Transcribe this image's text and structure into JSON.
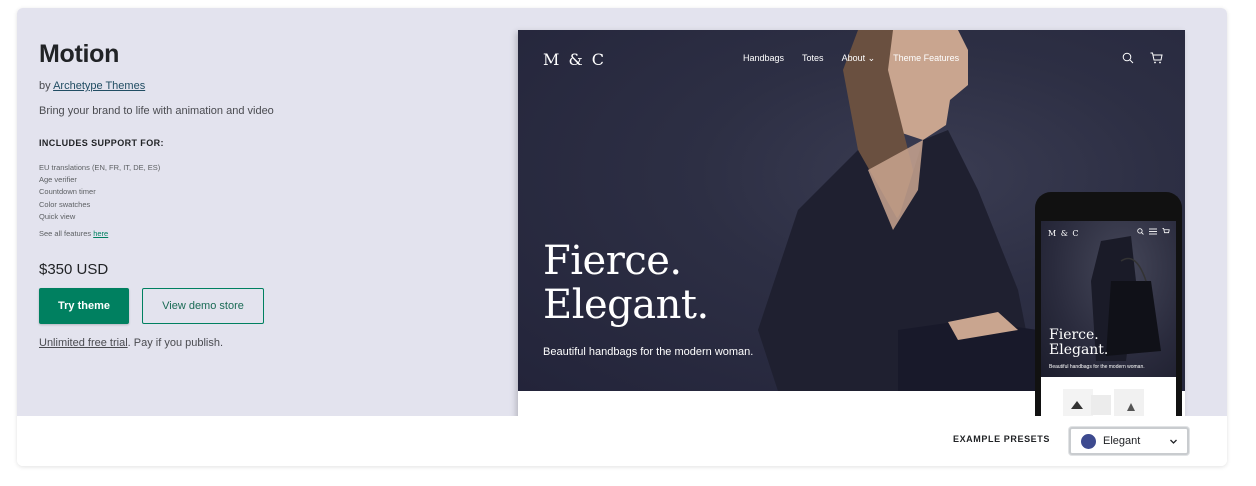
{
  "theme": {
    "title": "Motion",
    "by_prefix": "by ",
    "author": "Archetype Themes",
    "description": "Bring your brand to life with animation and video",
    "includes_heading": "INCLUDES SUPPORT FOR:",
    "features": [
      "EU translations (EN, FR, IT, DE, ES)",
      "Age verifier",
      "Countdown timer",
      "Color swatches",
      "Quick view"
    ],
    "see_all_prefix": "See all features ",
    "see_all_link": "here",
    "price": "$350 USD",
    "try_button": "Try theme",
    "demo_button": "View demo store",
    "trial_link": "Unlimited free trial",
    "trial_suffix": ". Pay if you publish."
  },
  "desktop_preview": {
    "logo": "M & C",
    "nav": [
      "Handbags",
      "Totes",
      "About",
      "Theme Features"
    ],
    "headline_line1": "Fierce.",
    "headline_line2": "Elegant.",
    "subtext": "Beautiful handbags for the modern woman."
  },
  "mobile_preview": {
    "logo": "M & C",
    "headline_line1": "Fierce.",
    "headline_line2": "Elegant.",
    "subtext": "Beautiful handbags for the modern woman."
  },
  "presets": {
    "label": "EXAMPLE PRESETS",
    "selected": "Elegant",
    "swatch_color": "#3d4a8f"
  },
  "colors": {
    "accent": "#008060",
    "hero_bg": "#e3e3ee"
  },
  "icons": [
    "search-icon",
    "cart-icon",
    "chevron-down-icon",
    "menu-icon"
  ]
}
